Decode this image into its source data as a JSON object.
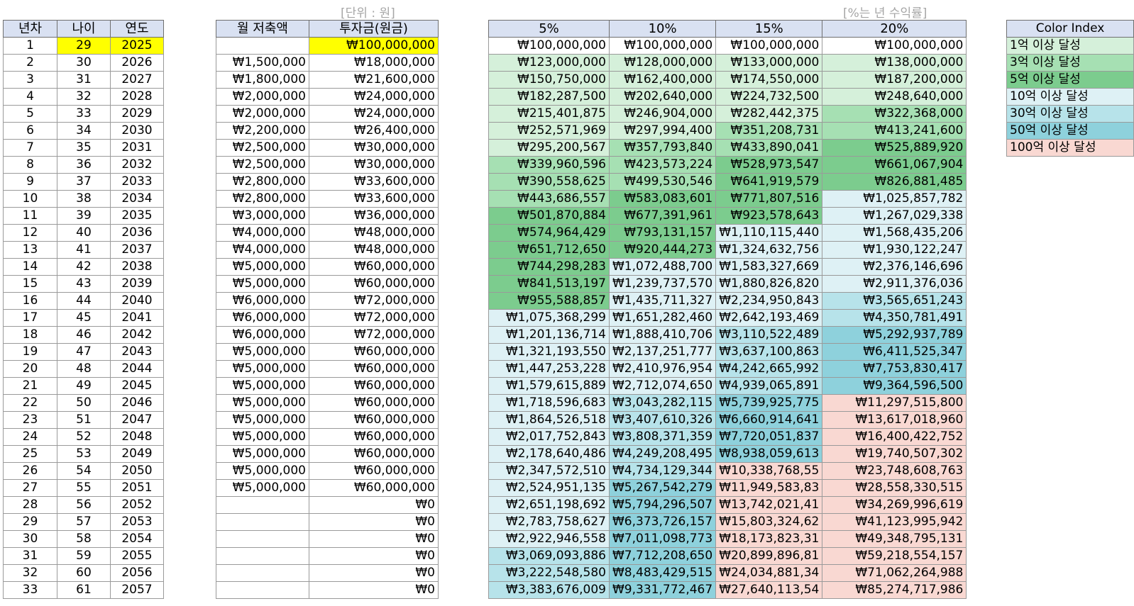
{
  "header_notes": {
    "unit": "[단위 : 원]",
    "rate_note": "[%는 년 수익률]"
  },
  "left_table": {
    "headers": [
      "년차",
      "나이",
      "연도"
    ],
    "rows": [
      [
        "1",
        "29",
        "2025"
      ],
      [
        "2",
        "30",
        "2026"
      ],
      [
        "3",
        "31",
        "2027"
      ],
      [
        "4",
        "32",
        "2028"
      ],
      [
        "5",
        "33",
        "2029"
      ],
      [
        "6",
        "34",
        "2030"
      ],
      [
        "7",
        "35",
        "2031"
      ],
      [
        "8",
        "36",
        "2032"
      ],
      [
        "9",
        "37",
        "2033"
      ],
      [
        "10",
        "38",
        "2034"
      ],
      [
        "11",
        "39",
        "2035"
      ],
      [
        "12",
        "40",
        "2036"
      ],
      [
        "13",
        "41",
        "2037"
      ],
      [
        "14",
        "42",
        "2038"
      ],
      [
        "15",
        "43",
        "2039"
      ],
      [
        "16",
        "44",
        "2040"
      ],
      [
        "17",
        "45",
        "2041"
      ],
      [
        "18",
        "46",
        "2042"
      ],
      [
        "19",
        "47",
        "2043"
      ],
      [
        "20",
        "48",
        "2044"
      ],
      [
        "21",
        "49",
        "2045"
      ],
      [
        "22",
        "50",
        "2046"
      ],
      [
        "23",
        "51",
        "2047"
      ],
      [
        "24",
        "52",
        "2048"
      ],
      [
        "25",
        "53",
        "2049"
      ],
      [
        "26",
        "54",
        "2050"
      ],
      [
        "27",
        "55",
        "2051"
      ],
      [
        "28",
        "56",
        "2052"
      ],
      [
        "29",
        "57",
        "2053"
      ],
      [
        "30",
        "58",
        "2054"
      ],
      [
        "31",
        "59",
        "2055"
      ],
      [
        "32",
        "60",
        "2056"
      ],
      [
        "33",
        "61",
        "2057"
      ]
    ]
  },
  "invest_table": {
    "headers": [
      "월 저축액",
      "투자금(원금)"
    ],
    "rows": [
      [
        "",
        "₩100,000,000"
      ],
      [
        "₩1,500,000",
        "₩18,000,000"
      ],
      [
        "₩1,800,000",
        "₩21,600,000"
      ],
      [
        "₩2,000,000",
        "₩24,000,000"
      ],
      [
        "₩2,000,000",
        "₩24,000,000"
      ],
      [
        "₩2,200,000",
        "₩26,400,000"
      ],
      [
        "₩2,500,000",
        "₩30,000,000"
      ],
      [
        "₩2,500,000",
        "₩30,000,000"
      ],
      [
        "₩2,800,000",
        "₩33,600,000"
      ],
      [
        "₩2,800,000",
        "₩33,600,000"
      ],
      [
        "₩3,000,000",
        "₩36,000,000"
      ],
      [
        "₩4,000,000",
        "₩48,000,000"
      ],
      [
        "₩4,000,000",
        "₩48,000,000"
      ],
      [
        "₩5,000,000",
        "₩60,000,000"
      ],
      [
        "₩5,000,000",
        "₩60,000,000"
      ],
      [
        "₩6,000,000",
        "₩72,000,000"
      ],
      [
        "₩6,000,000",
        "₩72,000,000"
      ],
      [
        "₩6,000,000",
        "₩72,000,000"
      ],
      [
        "₩5,000,000",
        "₩60,000,000"
      ],
      [
        "₩5,000,000",
        "₩60,000,000"
      ],
      [
        "₩5,000,000",
        "₩60,000,000"
      ],
      [
        "₩5,000,000",
        "₩60,000,000"
      ],
      [
        "₩5,000,000",
        "₩60,000,000"
      ],
      [
        "₩5,000,000",
        "₩60,000,000"
      ],
      [
        "₩5,000,000",
        "₩60,000,000"
      ],
      [
        "₩5,000,000",
        "₩60,000,000"
      ],
      [
        "₩5,000,000",
        "₩60,000,000"
      ],
      [
        "",
        "₩0"
      ],
      [
        "",
        "₩0"
      ],
      [
        "",
        "₩0"
      ],
      [
        "",
        "₩0"
      ],
      [
        "",
        "₩0"
      ],
      [
        "",
        "₩0"
      ]
    ]
  },
  "returns_table": {
    "headers": [
      "5%",
      "10%",
      "15%",
      "20%"
    ],
    "rows": [
      [
        "₩100,000,000",
        "₩100,000,000",
        "₩100,000,000",
        "₩100,000,000"
      ],
      [
        "₩123,000,000",
        "₩128,000,000",
        "₩133,000,000",
        "₩138,000,000"
      ],
      [
        "₩150,750,000",
        "₩162,400,000",
        "₩174,550,000",
        "₩187,200,000"
      ],
      [
        "₩182,287,500",
        "₩202,640,000",
        "₩224,732,500",
        "₩248,640,000"
      ],
      [
        "₩215,401,875",
        "₩246,904,000",
        "₩282,442,375",
        "₩322,368,000"
      ],
      [
        "₩252,571,969",
        "₩297,994,400",
        "₩351,208,731",
        "₩413,241,600"
      ],
      [
        "₩295,200,567",
        "₩357,793,840",
        "₩433,890,041",
        "₩525,889,920"
      ],
      [
        "₩339,960,596",
        "₩423,573,224",
        "₩528,973,547",
        "₩661,067,904"
      ],
      [
        "₩390,558,625",
        "₩499,530,546",
        "₩641,919,579",
        "₩826,881,485"
      ],
      [
        "₩443,686,557",
        "₩583,083,601",
        "₩771,807,516",
        "₩1,025,857,782"
      ],
      [
        "₩501,870,884",
        "₩677,391,961",
        "₩923,578,643",
        "₩1,267,029,338"
      ],
      [
        "₩574,964,429",
        "₩793,131,157",
        "₩1,110,115,440",
        "₩1,568,435,206"
      ],
      [
        "₩651,712,650",
        "₩920,444,273",
        "₩1,324,632,756",
        "₩1,930,122,247"
      ],
      [
        "₩744,298,283",
        "₩1,072,488,700",
        "₩1,583,327,669",
        "₩2,376,146,696"
      ],
      [
        "₩841,513,197",
        "₩1,239,737,570",
        "₩1,880,826,820",
        "₩2,911,376,036"
      ],
      [
        "₩955,588,857",
        "₩1,435,711,327",
        "₩2,234,950,843",
        "₩3,565,651,243"
      ],
      [
        "₩1,075,368,299",
        "₩1,651,282,460",
        "₩2,642,193,469",
        "₩4,350,781,491"
      ],
      [
        "₩1,201,136,714",
        "₩1,888,410,706",
        "₩3,110,522,489",
        "₩5,292,937,789"
      ],
      [
        "₩1,321,193,550",
        "₩2,137,251,777",
        "₩3,637,100,863",
        "₩6,411,525,347"
      ],
      [
        "₩1,447,253,228",
        "₩2,410,976,954",
        "₩4,242,665,992",
        "₩7,753,830,417"
      ],
      [
        "₩1,579,615,889",
        "₩2,712,074,650",
        "₩4,939,065,891",
        "₩9,364,596,500"
      ],
      [
        "₩1,718,596,683",
        "₩3,043,282,115",
        "₩5,739,925,775",
        "₩11,297,515,800"
      ],
      [
        "₩1,864,526,518",
        "₩3,407,610,326",
        "₩6,660,914,641",
        "₩13,617,018,960"
      ],
      [
        "₩2,017,752,843",
        "₩3,808,371,359",
        "₩7,720,051,837",
        "₩16,400,422,752"
      ],
      [
        "₩2,178,640,486",
        "₩4,249,208,495",
        "₩8,938,059,613",
        "₩19,740,507,302"
      ],
      [
        "₩2,347,572,510",
        "₩4,734,129,344",
        "₩10,338,768,55",
        "₩23,748,608,763"
      ],
      [
        "₩2,524,951,135",
        "₩5,267,542,279",
        "₩11,949,583,83",
        "₩28,558,330,515"
      ],
      [
        "₩2,651,198,692",
        "₩5,794,296,507",
        "₩13,742,021,41",
        "₩34,269,996,619"
      ],
      [
        "₩2,783,758,627",
        "₩6,373,726,157",
        "₩15,803,324,62",
        "₩41,123,995,942"
      ],
      [
        "₩2,922,946,558",
        "₩7,011,098,773",
        "₩18,173,823,31",
        "₩49,348,795,131"
      ],
      [
        "₩3,069,093,886",
        "₩7,712,208,650",
        "₩20,899,896,81",
        "₩59,218,554,157"
      ],
      [
        "₩3,222,548,580",
        "₩8,483,429,515",
        "₩24,034,881,34",
        "₩71,062,264,988"
      ],
      [
        "₩3,383,676,009",
        "₩9,331,772,467",
        "₩27,640,113,54",
        "₩85,274,717,986"
      ]
    ],
    "levels": [
      [
        0,
        0,
        0,
        0
      ],
      [
        1,
        1,
        1,
        1
      ],
      [
        1,
        1,
        1,
        1
      ],
      [
        1,
        1,
        1,
        1
      ],
      [
        1,
        1,
        1,
        2
      ],
      [
        1,
        1,
        2,
        2
      ],
      [
        1,
        2,
        2,
        3
      ],
      [
        2,
        2,
        3,
        3
      ],
      [
        2,
        2,
        3,
        3
      ],
      [
        2,
        3,
        3,
        4
      ],
      [
        3,
        3,
        3,
        4
      ],
      [
        3,
        3,
        4,
        4
      ],
      [
        3,
        3,
        4,
        4
      ],
      [
        3,
        4,
        4,
        4
      ],
      [
        3,
        4,
        4,
        4
      ],
      [
        3,
        4,
        4,
        5
      ],
      [
        4,
        4,
        4,
        5
      ],
      [
        4,
        4,
        5,
        6
      ],
      [
        4,
        4,
        5,
        6
      ],
      [
        4,
        4,
        5,
        6
      ],
      [
        4,
        4,
        5,
        6
      ],
      [
        4,
        5,
        6,
        7
      ],
      [
        4,
        5,
        6,
        7
      ],
      [
        4,
        5,
        6,
        7
      ],
      [
        4,
        5,
        6,
        7
      ],
      [
        4,
        5,
        7,
        7
      ],
      [
        4,
        6,
        7,
        7
      ],
      [
        4,
        6,
        7,
        7
      ],
      [
        4,
        6,
        7,
        7
      ],
      [
        4,
        6,
        7,
        7
      ],
      [
        5,
        6,
        7,
        7
      ],
      [
        5,
        6,
        7,
        7
      ],
      [
        5,
        6,
        7,
        7
      ]
    ]
  },
  "legend": {
    "title": "Color Index",
    "items": [
      {
        "label": "1억 이상 달성",
        "color": "#d5f0da"
      },
      {
        "label": "3억 이상 달성",
        "color": "#a6e0b3"
      },
      {
        "label": "5억 이상 달성",
        "color": "#7ccc8e"
      },
      {
        "label": "10억 이상 달성",
        "color": "#def1f5"
      },
      {
        "label": "30억 이상 달성",
        "color": "#b7e3ea"
      },
      {
        "label": "50억 이상 달성",
        "color": "#8ed1dc"
      },
      {
        "label": "100억 이상 달성",
        "color": "#f9d8d2"
      }
    ]
  },
  "colors": {
    "header_bg": "#d9e1f2",
    "highlight": "#ffff00"
  }
}
